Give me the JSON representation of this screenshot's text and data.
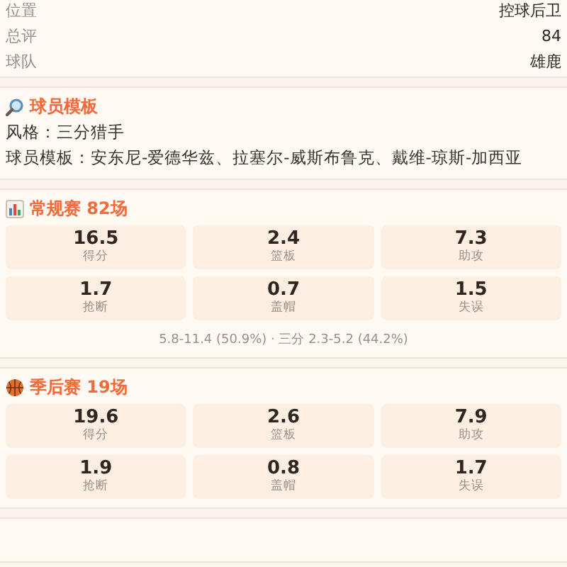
{
  "info_rows": [
    {
      "label": "位置",
      "value": "控球后卫"
    },
    {
      "label": "总评",
      "value": "84"
    },
    {
      "label": "球队",
      "value": "雄鹿"
    }
  ],
  "template": {
    "title": "球员模板",
    "lines": [
      "风格：三分猎手",
      "球员模板：安东尼-爱德华兹、拉塞尔-威斯布鲁克、戴维-琼斯-加西亚"
    ]
  },
  "stat_sections": [
    {
      "kind": "chart",
      "title": "常规赛 82场",
      "stats": [
        {
          "value": "16.5",
          "label": "得分"
        },
        {
          "value": "2.4",
          "label": "篮板"
        },
        {
          "value": "7.3",
          "label": "助攻"
        },
        {
          "value": "1.7",
          "label": "抢断"
        },
        {
          "value": "0.7",
          "label": "盖帽"
        },
        {
          "value": "1.5",
          "label": "失误"
        }
      ],
      "summary": "5.8-11.4 (50.9%) · 三分 2.3-5.2 (44.2%)"
    },
    {
      "kind": "ball",
      "title": "季后赛 19场",
      "stats": [
        {
          "value": "19.6",
          "label": "得分"
        },
        {
          "value": "2.6",
          "label": "篮板"
        },
        {
          "value": "7.9",
          "label": "助攻"
        },
        {
          "value": "1.9",
          "label": "抢断"
        },
        {
          "value": "0.8",
          "label": "盖帽"
        },
        {
          "value": "1.7",
          "label": "失误"
        }
      ]
    }
  ]
}
